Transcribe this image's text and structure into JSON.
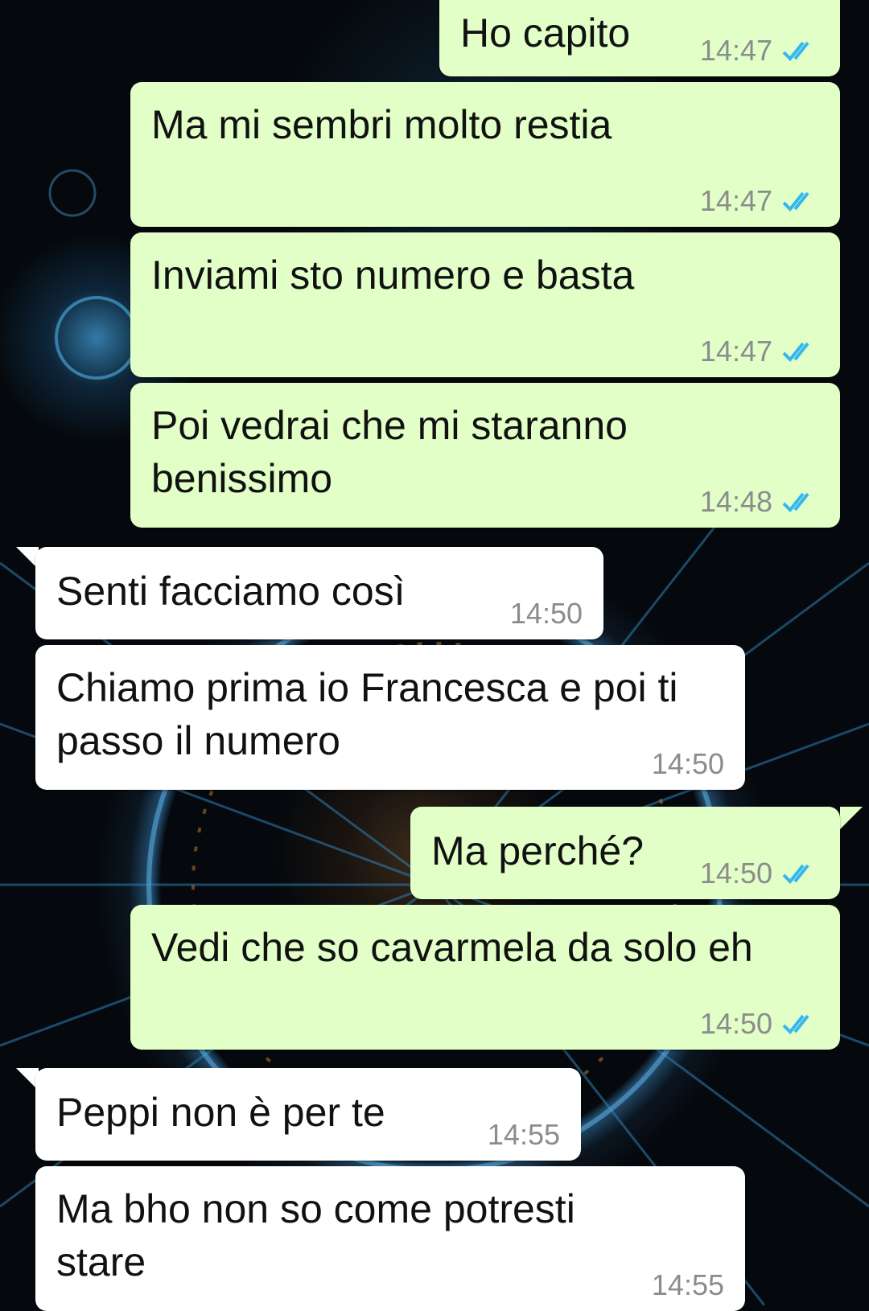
{
  "colors": {
    "outgoing_bubble": "#e1ffc7",
    "incoming_bubble": "#ffffff",
    "timestamp": "#8c8c8c",
    "read_ticks": "#34b7f1"
  },
  "messages": [
    {
      "direction": "outgoing",
      "text": "Ho capito",
      "time": "14:47",
      "status_icon": "double-check-read-icon"
    },
    {
      "direction": "outgoing",
      "text": "Ma mi sembri molto restia",
      "time": "14:47",
      "status_icon": "double-check-read-icon"
    },
    {
      "direction": "outgoing",
      "text": "Inviami sto numero e basta",
      "time": "14:47",
      "status_icon": "double-check-read-icon"
    },
    {
      "direction": "outgoing",
      "text": "Poi vedrai che mi staranno benissimo",
      "time": "14:48",
      "status_icon": "double-check-read-icon"
    },
    {
      "direction": "incoming",
      "text": "Senti facciamo così",
      "time": "14:50"
    },
    {
      "direction": "incoming",
      "text": "Chiamo prima io Francesca e poi ti passo il numero",
      "time": "14:50"
    },
    {
      "direction": "outgoing",
      "text": "Ma perché?",
      "time": "14:50",
      "status_icon": "double-check-read-icon"
    },
    {
      "direction": "outgoing",
      "text": "Vedi che so cavarmela da solo eh",
      "time": "14:50",
      "status_icon": "double-check-read-icon"
    },
    {
      "direction": "incoming",
      "text": "Peppi non è per te",
      "time": "14:55"
    },
    {
      "direction": "incoming",
      "text": "Ma bho non so come potresti stare",
      "time": "14:55"
    }
  ]
}
